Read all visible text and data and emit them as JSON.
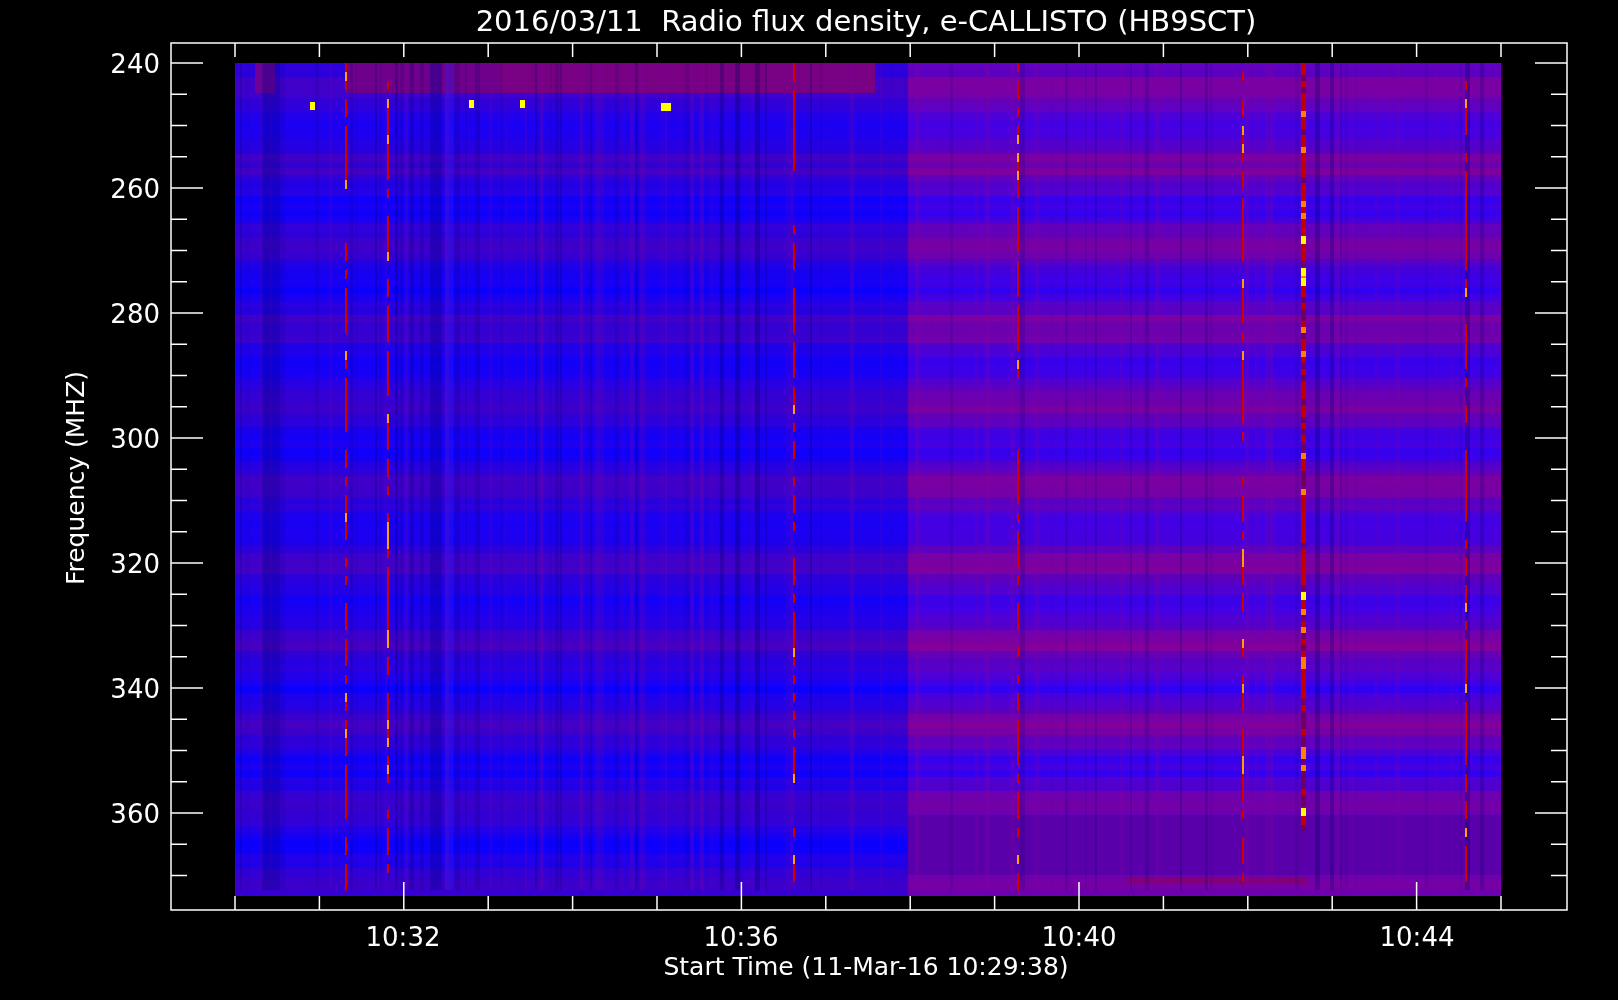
{
  "title": "2016/03/11  Radio flux density, e-CALLISTO (HB9SCT)",
  "chart": {
    "ylabel": "Frequency (MHZ)",
    "yticks": [
      "240",
      "260",
      "280",
      "300",
      "320",
      "340",
      "360"
    ],
    "xlabel": "Start Time (11-Mar-16 10:29:38)",
    "xticks": [
      "10:32",
      "10:36",
      "10:40",
      "10:44"
    ]
  }
}
